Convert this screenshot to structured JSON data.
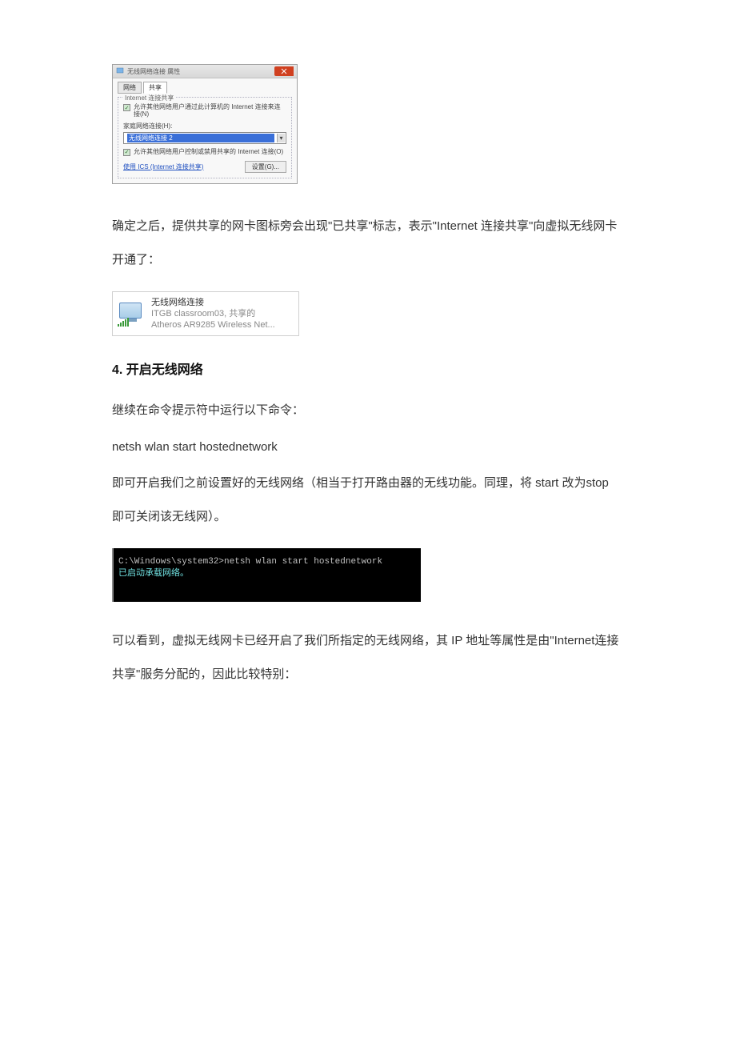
{
  "dialog1": {
    "title": "无线网络连接 属性",
    "tab_network": "网络",
    "tab_sharing": "共享",
    "groupbox_title": "Internet  连接共享",
    "chk1": "允许其他网络用户通过此计算机的 Internet 连接来连接(N)",
    "sub_label": "家庭网络连接(H):",
    "dropdown_value": "无线网络连接 2",
    "chk2": "允许其他网络用户控制或禁用共享的 Internet 连接(O)",
    "ics_link": "使用 ICS (Internet 连接共享)",
    "settings_btn": "设置(G)..."
  },
  "para1": "确定之后，提供共享的网卡图标旁会出现\"已共享\"标志，表示\"Internet 连接共享\"向虚拟无线网卡开通了：",
  "net_panel": {
    "line1": "无线网络连接",
    "line2": "ITGB classroom03, 共享的",
    "line3": "Atheros AR9285 Wireless Net..."
  },
  "heading": "4.    开启无线网络",
  "para2": "继续在命令提示符中运行以下命令：",
  "cmd": "netsh  wlan  start  hostednetwork",
  "para3": "即可开启我们之前设置好的无线网络（相当于打开路由器的无线功能。同理，将 start 改为stop 即可关闭该无线网）。",
  "console": {
    "line1": "C:\\Windows\\system32>netsh wlan start hostednetwork",
    "line2": "已启动承载网络。"
  },
  "para4": "可以看到，虚拟无线网卡已经开启了我们所指定的无线网络，其 IP 地址等属性是由\"Internet连接共享\"服务分配的，因此比较特别："
}
